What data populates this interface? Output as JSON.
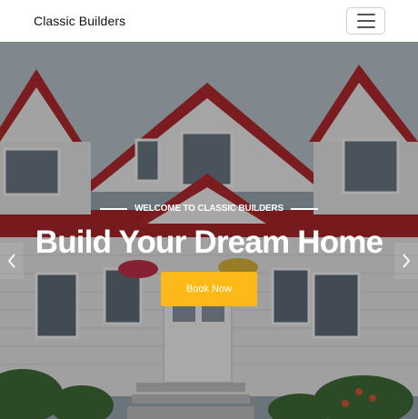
{
  "navbar": {
    "brand": "Classic Builders",
    "toggler_icon": "hamburger-menu-icon"
  },
  "hero": {
    "eyebrow": "WELCOME TO CLASSIC BUILDERS",
    "headline": "Build Your Dream Home",
    "cta_label": "Book Now",
    "prev_icon": "chevron-left-icon",
    "next_icon": "chevron-right-icon"
  },
  "colors": {
    "accent": "#fdb917",
    "roof": "#b3262c",
    "siding": "#e9e9ea"
  }
}
